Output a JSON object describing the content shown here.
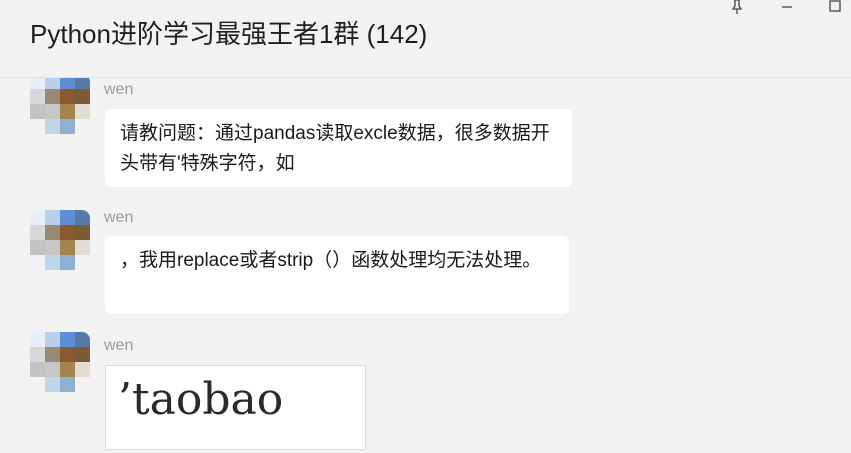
{
  "window": {
    "title": "Python进阶学习最强王者1群 (142)",
    "controls": {
      "pin_icon": "pin-icon",
      "minimize_icon": "minimize-icon",
      "maximize_icon": "maximize-icon"
    }
  },
  "messages": [
    {
      "sender": "wen",
      "text": "请教问题：通过pandas读取excle数据，很多数据开头带有'特殊字符，如"
    },
    {
      "sender": "wen",
      "text": "，我用replace或者strip（）函数处理均无法处理。"
    },
    {
      "sender": "wen",
      "image_text": "’taobao"
    }
  ],
  "colors": {
    "background": "#f2f2f2",
    "bubble": "#ffffff",
    "sender_name": "#9a9a9a",
    "title_text": "#1f1f1f"
  }
}
